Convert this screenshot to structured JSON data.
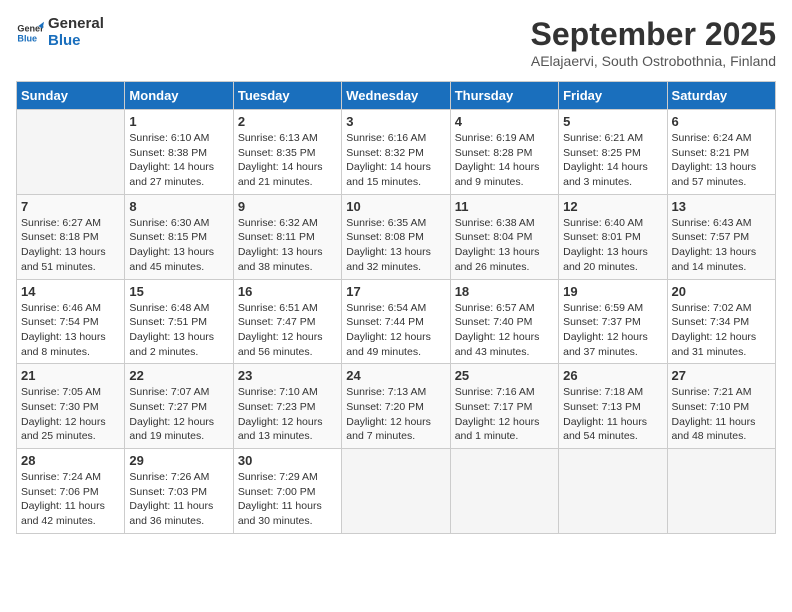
{
  "logo": {
    "text_general": "General",
    "text_blue": "Blue"
  },
  "title": "September 2025",
  "subtitle": "AElajaervi, South Ostrobothnia, Finland",
  "days_of_week": [
    "Sunday",
    "Monday",
    "Tuesday",
    "Wednesday",
    "Thursday",
    "Friday",
    "Saturday"
  ],
  "weeks": [
    [
      {
        "day": "",
        "info": ""
      },
      {
        "day": "1",
        "info": "Sunrise: 6:10 AM\nSunset: 8:38 PM\nDaylight: 14 hours and 27 minutes."
      },
      {
        "day": "2",
        "info": "Sunrise: 6:13 AM\nSunset: 8:35 PM\nDaylight: 14 hours and 21 minutes."
      },
      {
        "day": "3",
        "info": "Sunrise: 6:16 AM\nSunset: 8:32 PM\nDaylight: 14 hours and 15 minutes."
      },
      {
        "day": "4",
        "info": "Sunrise: 6:19 AM\nSunset: 8:28 PM\nDaylight: 14 hours and 9 minutes."
      },
      {
        "day": "5",
        "info": "Sunrise: 6:21 AM\nSunset: 8:25 PM\nDaylight: 14 hours and 3 minutes."
      },
      {
        "day": "6",
        "info": "Sunrise: 6:24 AM\nSunset: 8:21 PM\nDaylight: 13 hours and 57 minutes."
      }
    ],
    [
      {
        "day": "7",
        "info": "Sunrise: 6:27 AM\nSunset: 8:18 PM\nDaylight: 13 hours and 51 minutes."
      },
      {
        "day": "8",
        "info": "Sunrise: 6:30 AM\nSunset: 8:15 PM\nDaylight: 13 hours and 45 minutes."
      },
      {
        "day": "9",
        "info": "Sunrise: 6:32 AM\nSunset: 8:11 PM\nDaylight: 13 hours and 38 minutes."
      },
      {
        "day": "10",
        "info": "Sunrise: 6:35 AM\nSunset: 8:08 PM\nDaylight: 13 hours and 32 minutes."
      },
      {
        "day": "11",
        "info": "Sunrise: 6:38 AM\nSunset: 8:04 PM\nDaylight: 13 hours and 26 minutes."
      },
      {
        "day": "12",
        "info": "Sunrise: 6:40 AM\nSunset: 8:01 PM\nDaylight: 13 hours and 20 minutes."
      },
      {
        "day": "13",
        "info": "Sunrise: 6:43 AM\nSunset: 7:57 PM\nDaylight: 13 hours and 14 minutes."
      }
    ],
    [
      {
        "day": "14",
        "info": "Sunrise: 6:46 AM\nSunset: 7:54 PM\nDaylight: 13 hours and 8 minutes."
      },
      {
        "day": "15",
        "info": "Sunrise: 6:48 AM\nSunset: 7:51 PM\nDaylight: 13 hours and 2 minutes."
      },
      {
        "day": "16",
        "info": "Sunrise: 6:51 AM\nSunset: 7:47 PM\nDaylight: 12 hours and 56 minutes."
      },
      {
        "day": "17",
        "info": "Sunrise: 6:54 AM\nSunset: 7:44 PM\nDaylight: 12 hours and 49 minutes."
      },
      {
        "day": "18",
        "info": "Sunrise: 6:57 AM\nSunset: 7:40 PM\nDaylight: 12 hours and 43 minutes."
      },
      {
        "day": "19",
        "info": "Sunrise: 6:59 AM\nSunset: 7:37 PM\nDaylight: 12 hours and 37 minutes."
      },
      {
        "day": "20",
        "info": "Sunrise: 7:02 AM\nSunset: 7:34 PM\nDaylight: 12 hours and 31 minutes."
      }
    ],
    [
      {
        "day": "21",
        "info": "Sunrise: 7:05 AM\nSunset: 7:30 PM\nDaylight: 12 hours and 25 minutes."
      },
      {
        "day": "22",
        "info": "Sunrise: 7:07 AM\nSunset: 7:27 PM\nDaylight: 12 hours and 19 minutes."
      },
      {
        "day": "23",
        "info": "Sunrise: 7:10 AM\nSunset: 7:23 PM\nDaylight: 12 hours and 13 minutes."
      },
      {
        "day": "24",
        "info": "Sunrise: 7:13 AM\nSunset: 7:20 PM\nDaylight: 12 hours and 7 minutes."
      },
      {
        "day": "25",
        "info": "Sunrise: 7:16 AM\nSunset: 7:17 PM\nDaylight: 12 hours and 1 minute."
      },
      {
        "day": "26",
        "info": "Sunrise: 7:18 AM\nSunset: 7:13 PM\nDaylight: 11 hours and 54 minutes."
      },
      {
        "day": "27",
        "info": "Sunrise: 7:21 AM\nSunset: 7:10 PM\nDaylight: 11 hours and 48 minutes."
      }
    ],
    [
      {
        "day": "28",
        "info": "Sunrise: 7:24 AM\nSunset: 7:06 PM\nDaylight: 11 hours and 42 minutes."
      },
      {
        "day": "29",
        "info": "Sunrise: 7:26 AM\nSunset: 7:03 PM\nDaylight: 11 hours and 36 minutes."
      },
      {
        "day": "30",
        "info": "Sunrise: 7:29 AM\nSunset: 7:00 PM\nDaylight: 11 hours and 30 minutes."
      },
      {
        "day": "",
        "info": ""
      },
      {
        "day": "",
        "info": ""
      },
      {
        "day": "",
        "info": ""
      },
      {
        "day": "",
        "info": ""
      }
    ]
  ]
}
